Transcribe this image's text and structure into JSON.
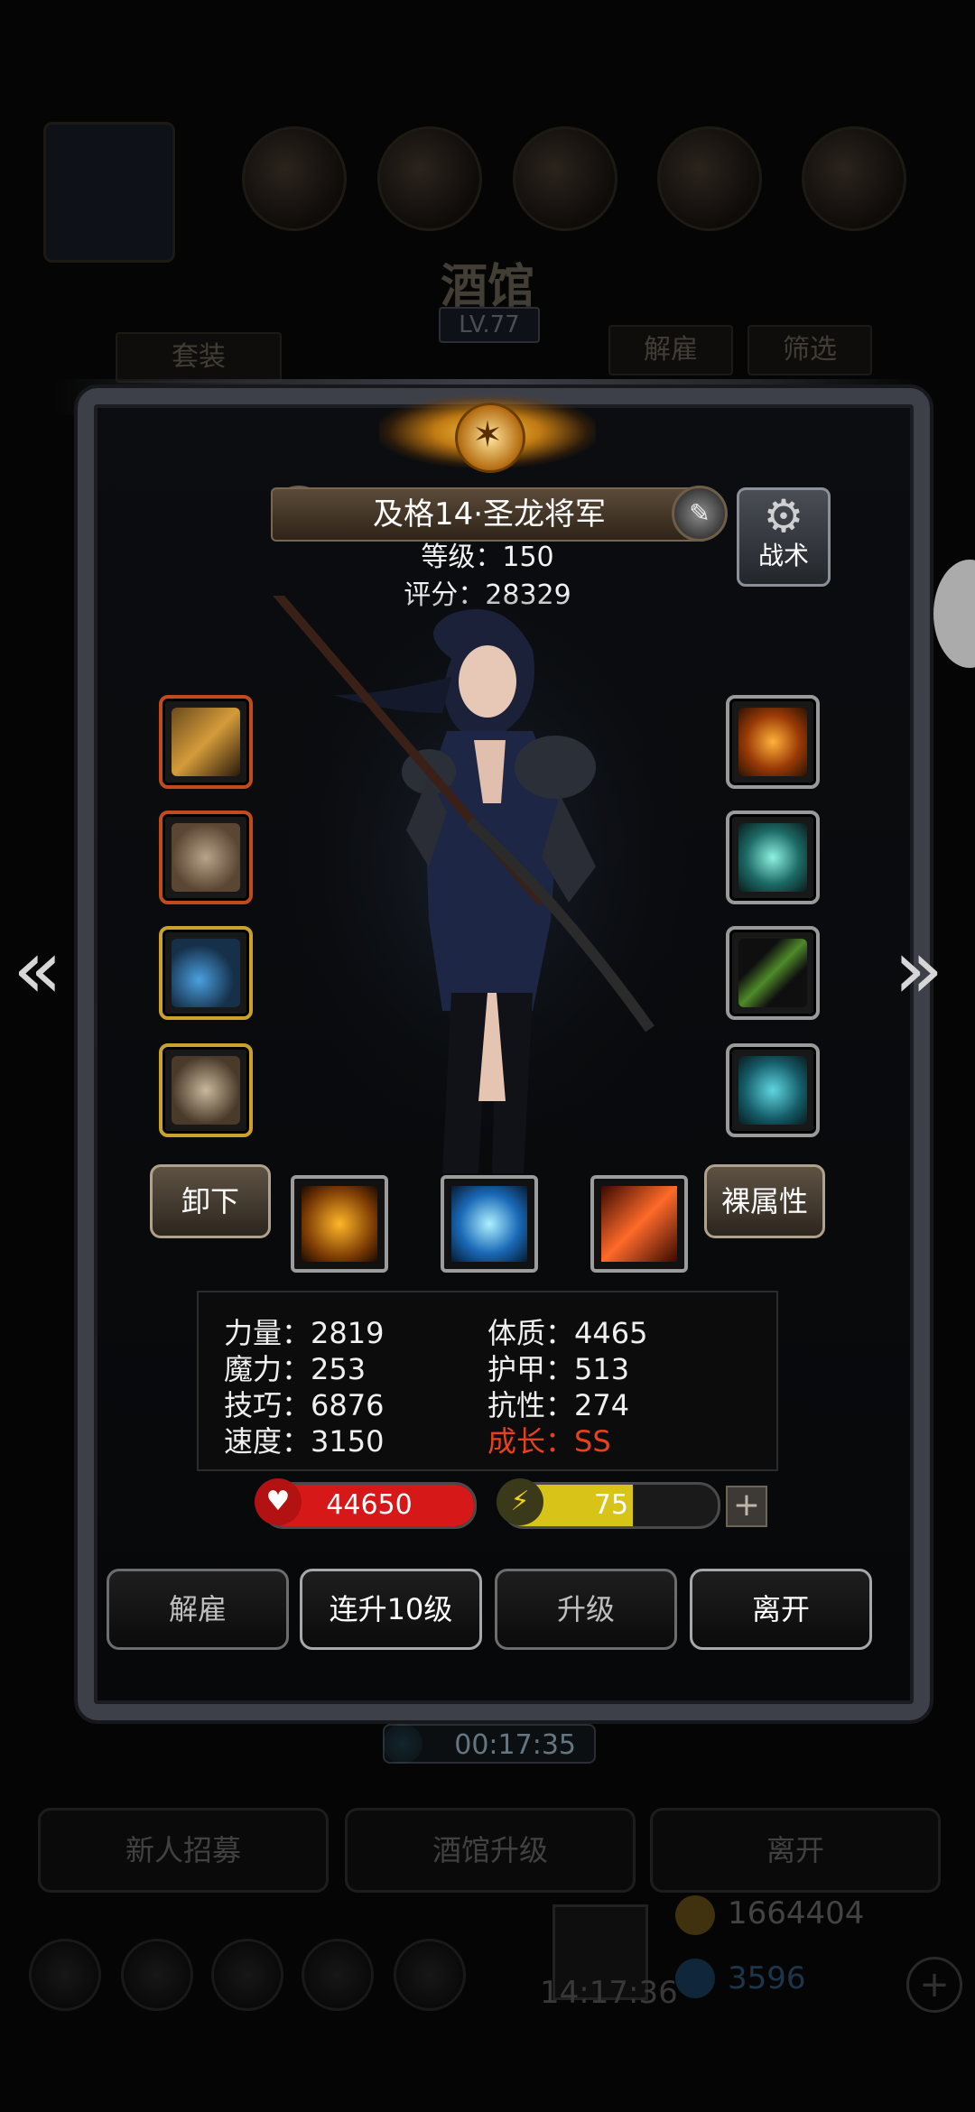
{
  "background": {
    "title": "酒馆",
    "level": "LV.77",
    "btn_suit": "套装",
    "btn_dismiss": "解雇",
    "btn_filter": "筛选",
    "bottom_buttons": [
      "新人招募",
      "酒馆升级",
      "离开"
    ],
    "gold": "1664404",
    "gems": "3596",
    "clock": "14:17:36",
    "timer": "00:17:35"
  },
  "hero": {
    "name": "及格14·圣龙将军",
    "level_text": "等级：150",
    "score_text": "评分：28329",
    "tactics_label": "战术"
  },
  "equipment": {
    "left": [
      {
        "icon": "sword-icon",
        "frame": "red"
      },
      {
        "icon": "armor-icon",
        "frame": "red"
      },
      {
        "icon": "necklace-icon",
        "frame": "gold"
      },
      {
        "icon": "shield-charm-icon",
        "frame": "gold"
      }
    ],
    "right": [
      {
        "icon": "fire-ring-icon",
        "frame": "gray"
      },
      {
        "icon": "crystal-icon",
        "frame": "gray"
      },
      {
        "icon": "staff-icon",
        "frame": "gray"
      },
      {
        "icon": "gem-icon",
        "frame": "gray"
      }
    ]
  },
  "actions_row": {
    "unequip": "卸下",
    "bare_stats": "裸属性",
    "skills": [
      "shield-skill-icon",
      "eye-skill-icon",
      "slash-skill-icon"
    ]
  },
  "stats": {
    "strength": "力量：2819",
    "magic": "魔力：253",
    "skill": "技巧：6876",
    "speed": "速度：3150",
    "constitution": "体质：4465",
    "armor": "护甲：513",
    "resistance": "抗性：274",
    "growth": "成长：SS"
  },
  "bars": {
    "hp": {
      "value": "44650",
      "fraction": 1.0,
      "color": "#d61818"
    },
    "energy": {
      "value": "75",
      "fraction": 0.6,
      "color": "#d8c418"
    }
  },
  "buttons": {
    "dismiss": "解雇",
    "upgrade10": "连升10级",
    "upgrade": "升级",
    "leave": "离开"
  }
}
